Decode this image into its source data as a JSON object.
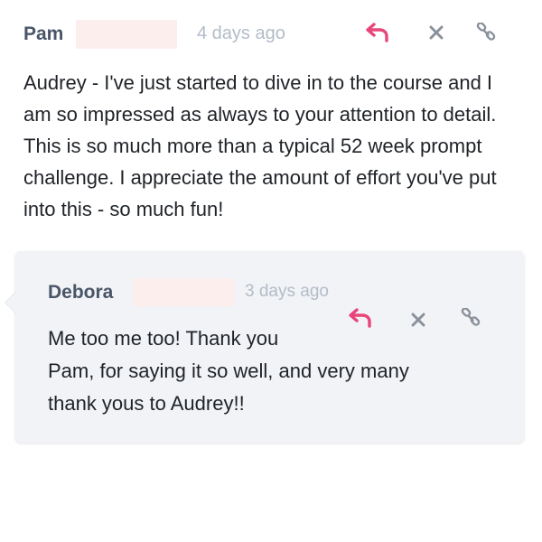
{
  "comment": {
    "author": "Pam",
    "timestamp": "4 days ago",
    "body": "Audrey - I've just started to dive in to the course and I am so impressed as always to your attention to detail.  This is so much more than a typical 52 week prompt challenge.  I appreciate the amount of effort you've put into this - so much fun!",
    "actions": {
      "reply_icon": "reply-arrow-icon",
      "delete_icon": "close-x-icon",
      "link_icon": "chain-link-icon"
    }
  },
  "reply": {
    "author": "Debora",
    "timestamp": "3 days ago",
    "body_lines": [
      "Me too me too!  Thank you",
      "Pam, for saying it so well, and very many",
      "thank yous to Audrey!!"
    ],
    "actions": {
      "reply_icon": "reply-arrow-icon",
      "delete_icon": "close-x-icon",
      "link_icon": "chain-link-icon"
    }
  },
  "colors": {
    "author_text": "#4a5568",
    "timestamp_text": "#b3bcc8",
    "body_text": "#1f2328",
    "reply_accent": "#e8457a",
    "icon_gray": "#8a919b",
    "reply_card_bg": "#f1f3f6",
    "redaction": "#fdeeee"
  }
}
